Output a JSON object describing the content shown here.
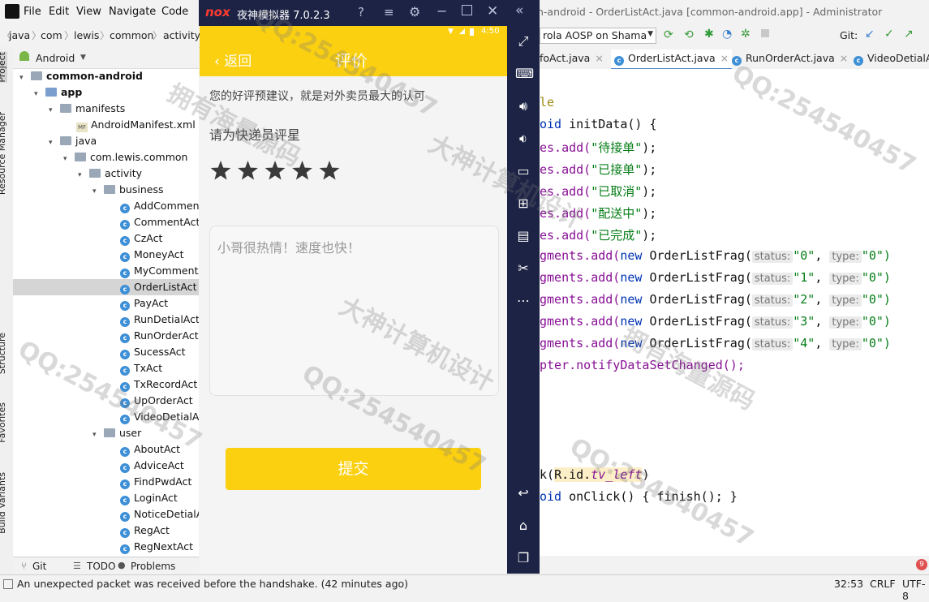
{
  "ide": {
    "menu": [
      "File",
      "Edit",
      "View",
      "Navigate",
      "Code"
    ],
    "window_title": "n-android - OrderListAct.java [common-android.app] - Administrator",
    "breadcrumb": [
      "java",
      "com",
      "lewis",
      "common",
      "activity"
    ],
    "run_config": "rola AOSP on Shama",
    "git_label": "Git:",
    "project_view": "Android",
    "left_tabs": [
      "Project",
      "Resource Manager",
      "Structure",
      "Favorites",
      "Build Variants"
    ],
    "tree": {
      "root": "common-android",
      "app": "app",
      "manifests": "manifests",
      "manifest_file": "AndroidManifest.xml",
      "java": "java",
      "package": "com.lewis.common",
      "activity": "activity",
      "business": "business",
      "business_classes": [
        "AddComment",
        "CommentAct",
        "CzAct",
        "MoneyAct",
        "MyCommentA",
        "OrderListAct",
        "PayAct",
        "RunDetialAct",
        "RunOrderAct",
        "SucessAct",
        "TxAct",
        "TxRecordAct",
        "UpOrderAct",
        "VideoDetialA"
      ],
      "user": "user",
      "user_classes": [
        "AboutAct",
        "AdviceAct",
        "FindPwdAct",
        "LoginAct",
        "NoticeDetialA",
        "RegAct",
        "RegNextAct"
      ],
      "selected": "OrderListAct"
    },
    "tabs": [
      "foAct.java",
      "OrderListAct.java",
      "RunOrderAct.java",
      "VideoDetialA"
    ],
    "bottom_tools": [
      "Git",
      "TODO",
      "Problems"
    ],
    "status_message": "An unexpected packet was received before the handshake. (42 minutes ago)",
    "position": "32:53",
    "line_ending": "CRLF",
    "encoding": "UTF-8",
    "notification_count": "9",
    "code": {
      "l1": "le",
      "l2_kw": "oid",
      "l2": " initData() {",
      "tabs_prefix": "es.add(",
      "tab_titles": [
        "\"待接单\"",
        "\"已接单\"",
        "\"已取消\"",
        "\"配送中\"",
        "\"已完成\""
      ],
      "line_end": ");",
      "frag_prefix": "gments.add(",
      "new_kw": "new",
      "frag_class": " OrderListFrag(",
      "status_hint": "status:",
      "type_hint": "type:",
      "status_values": [
        "\"0\"",
        "\"1\"",
        "\"2\"",
        "\"3\"",
        "\"4\""
      ],
      "type_value": "\"0\")",
      "adapter_line": "pter.notifyDataSetChanged();",
      "click_prefix": "k(",
      "click_arg": "R.id.",
      "click_field": "tv_left",
      "click_end": ")",
      "onclick_kw": "oid",
      "onclick": " onClick() { finish(); }"
    }
  },
  "emulator": {
    "brand": "nox",
    "title": "夜神模拟器 7.0.2.3",
    "phone": {
      "status_time": "4:50",
      "back_label": "返回",
      "page_title": "评价",
      "intro": "您的好评预建议，就是对外卖员最大的认可",
      "rating_label": "请为快递员评星",
      "rating": 5,
      "rating_max": 5,
      "comment": "小哥很热情！速度也快！",
      "submit_label": "提交"
    }
  },
  "watermarks": [
    "QQ:254540457",
    "拥有海量源码",
    "大神计算机设计"
  ],
  "colors": {
    "accent_yellow": "#fbd011",
    "emulator_frame": "#1c2345",
    "star": "#3a3a3a"
  }
}
